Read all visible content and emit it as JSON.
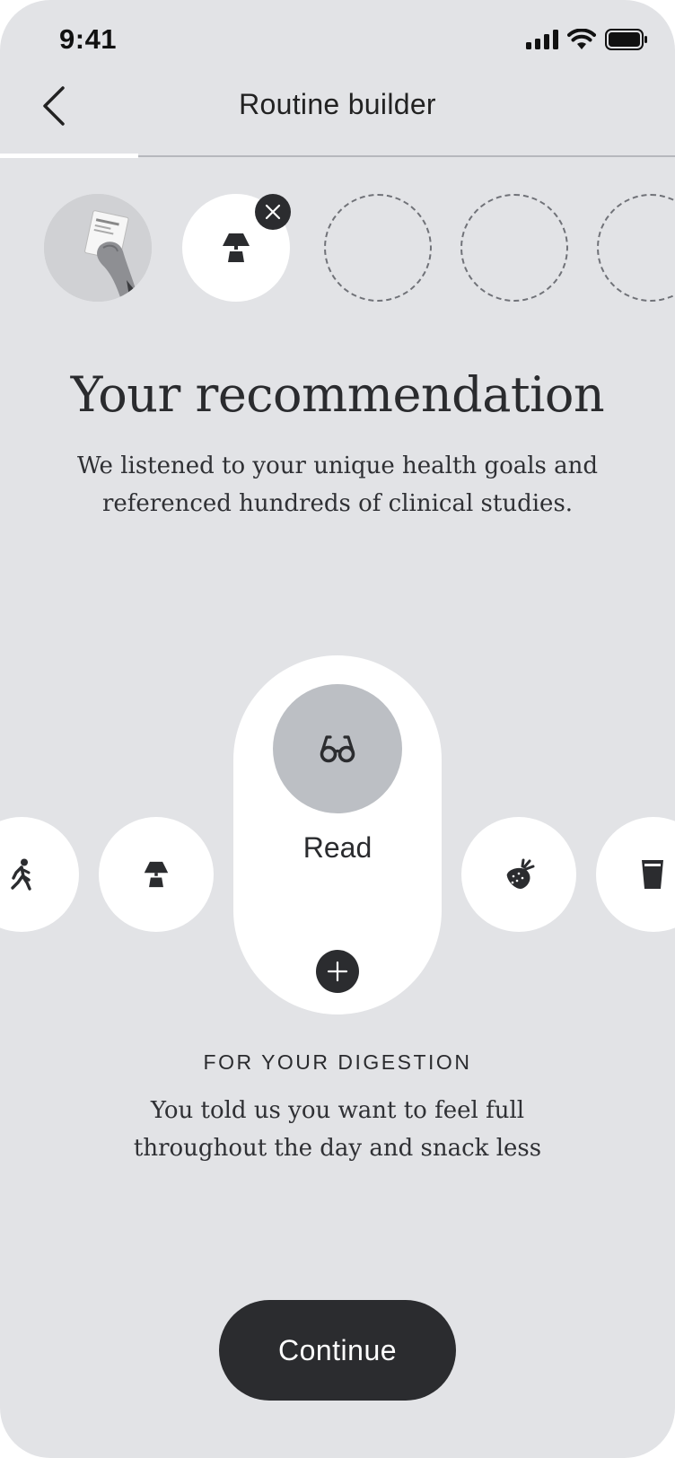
{
  "status_bar": {
    "time": "9:41",
    "icons": [
      "signal-icon",
      "wifi-icon",
      "battery-icon"
    ]
  },
  "header": {
    "title": "Routine builder",
    "back_icon": "chevron-left-icon"
  },
  "progress": {
    "fraction": 0.2
  },
  "steps": [
    {
      "state": "completed",
      "content": "hand-holding-card-photo"
    },
    {
      "state": "current",
      "icon": "lamp-icon"
    },
    {
      "state": "empty"
    },
    {
      "state": "empty"
    },
    {
      "state": "empty"
    }
  ],
  "main": {
    "heading": "Your recommendation",
    "subtext": "We listened to your unique health goals and referenced hundreds of clinical studies."
  },
  "carousel": {
    "items": [
      {
        "icon": "walking-icon"
      },
      {
        "icon": "lamp-icon"
      },
      {
        "icon": "glasses-icon",
        "label": "Read",
        "selected": true
      },
      {
        "icon": "strawberry-icon"
      },
      {
        "icon": "glass-icon"
      }
    ]
  },
  "recommendation": {
    "overline": "FOR YOUR DIGESTION",
    "reason": "You told us you want to feel full throughout the day and snack less"
  },
  "footer": {
    "continue_label": "Continue"
  },
  "colors": {
    "background": "#e2e3e6",
    "dark": "#2b2c2f",
    "card": "#ffffff",
    "icon_circle": "#bcbfc4"
  }
}
